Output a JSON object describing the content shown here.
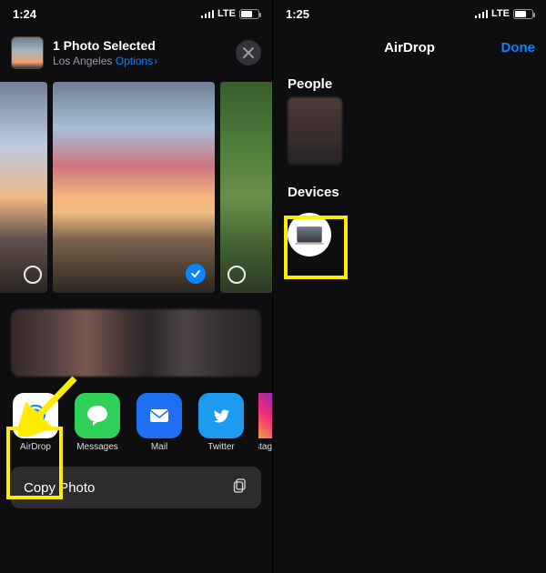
{
  "left": {
    "status": {
      "time": "1:24",
      "network": "LTE"
    },
    "header": {
      "title": "1 Photo Selected",
      "subtitle_location": "Los Angeles",
      "options_label": "Options"
    },
    "apps": [
      {
        "key": "airdrop",
        "label": "AirDrop"
      },
      {
        "key": "messages",
        "label": "Messages"
      },
      {
        "key": "mail",
        "label": "Mail"
      },
      {
        "key": "twitter",
        "label": "Twitter"
      },
      {
        "key": "insta",
        "label": "Instagram"
      }
    ],
    "actions": {
      "copy_photo": "Copy Photo"
    }
  },
  "right": {
    "status": {
      "time": "1:25",
      "network": "LTE"
    },
    "nav": {
      "title": "AirDrop",
      "done": "Done"
    },
    "sections": {
      "people": "People",
      "devices": "Devices"
    }
  }
}
